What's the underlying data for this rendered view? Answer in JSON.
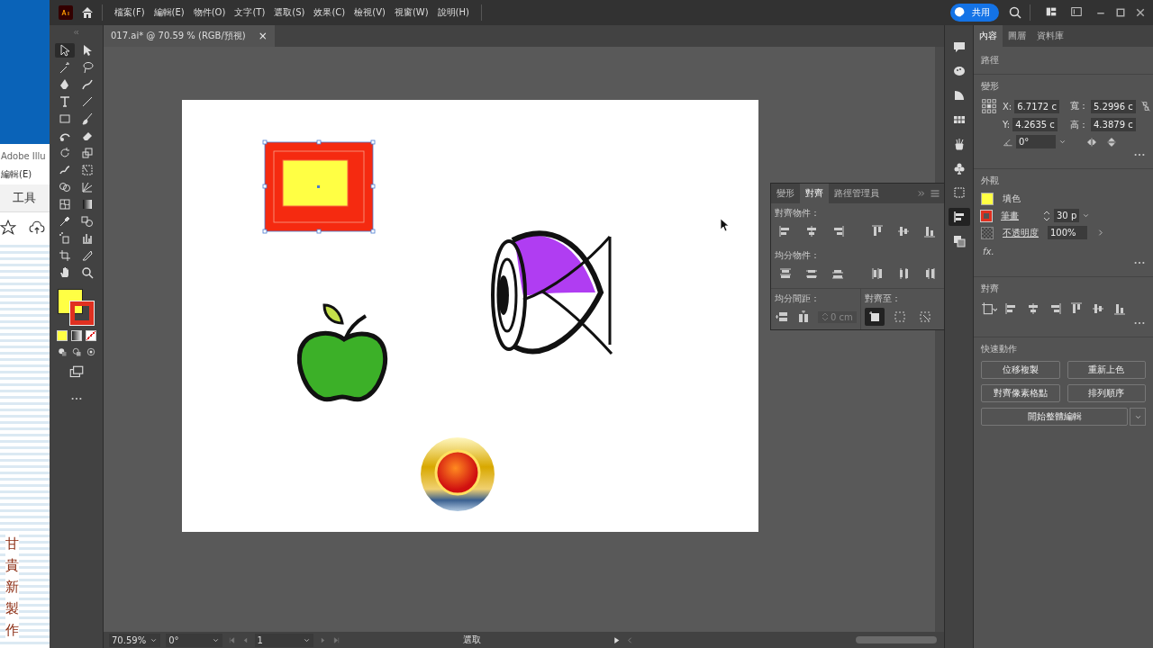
{
  "background_window": {
    "title": "Adobe Illu",
    "menu_item": "編輯(E)",
    "tab": "工具",
    "vertical_text": "甘貴新製作"
  },
  "menu": [
    "檔案(F)",
    "編輯(E)",
    "物件(O)",
    "文字(T)",
    "選取(S)",
    "效果(C)",
    "檢視(V)",
    "視窗(W)",
    "說明(H)"
  ],
  "share_button": "共用",
  "document_tab": {
    "title": "017.ai* @ 70.59 % (RGB/預視)",
    "close": "×"
  },
  "tools": [
    {
      "selected": true
    },
    {
      "selected": false
    },
    {
      "selected": false
    },
    {
      "selected": false
    },
    {
      "selected": false
    },
    {
      "selected": false
    },
    {
      "selected": false
    },
    {
      "selected": false
    },
    {
      "selected": false
    },
    {
      "selected": false
    },
    {
      "selected": false
    },
    {
      "selected": false
    },
    {
      "selected": false
    },
    {
      "selected": false
    },
    {
      "selected": false
    },
    {
      "selected": false
    },
    {
      "selected": false
    },
    {
      "selected": false
    },
    {
      "selected": false
    },
    {
      "selected": false
    },
    {
      "selected": false
    },
    {
      "selected": false
    },
    {
      "selected": false
    },
    {
      "selected": false
    },
    {
      "selected": false
    },
    {
      "selected": false
    },
    {
      "selected": false
    },
    {
      "selected": false
    }
  ],
  "align_panel": {
    "tabs": [
      {
        "label": "變形",
        "selected": false
      },
      {
        "label": "對齊",
        "selected": true
      },
      {
        "label": "路徑管理員",
        "selected": false
      }
    ],
    "align_objects": "對齊物件：",
    "distribute_objects": "均分物件：",
    "distribute_spacing": "均分間距：",
    "spacing_value": "0 cm",
    "align_to": "對齊至：",
    "align_to_options": [
      {
        "selected": true
      },
      {
        "selected": false
      },
      {
        "selected": false
      }
    ]
  },
  "side_strip": [
    {
      "selected": false
    },
    {
      "selected": false
    },
    {
      "selected": false
    },
    {
      "selected": false
    },
    {
      "selected": false
    },
    {
      "selected": false
    },
    {
      "selected": false
    },
    {
      "selected": true
    },
    {
      "selected": false
    }
  ],
  "properties": {
    "tabs": [
      {
        "label": "內容",
        "selected": true
      },
      {
        "label": "圖層",
        "selected": false
      },
      {
        "label": "資料庫",
        "selected": false
      }
    ],
    "object_type": "路徑",
    "transform": {
      "title": "變形",
      "x_label": "X:",
      "x": "6.7172 c",
      "y_label": "Y:",
      "y": "4.2635 c",
      "w_label": "寬：",
      "w": "5.2996 c",
      "h_label": "高：",
      "h": "4.3879 c",
      "angle": "0°"
    },
    "appearance": {
      "title": "外觀",
      "fill_label": "填色",
      "stroke_label": "筆畫",
      "stroke_weight": "30 p",
      "opacity_label": "不透明度",
      "opacity": "100%",
      "fx": "fx."
    },
    "align_title": "對齊",
    "quick_actions": {
      "title": "快速動作",
      "buttons": [
        "位移複製",
        "重新上色",
        "對齊像素格點",
        "排列順序"
      ],
      "wide_button": "開始整體編輯"
    }
  },
  "status_bar": {
    "zoom": "70.59%",
    "rotation": "0°",
    "artboard": "1",
    "tool": "選取"
  }
}
